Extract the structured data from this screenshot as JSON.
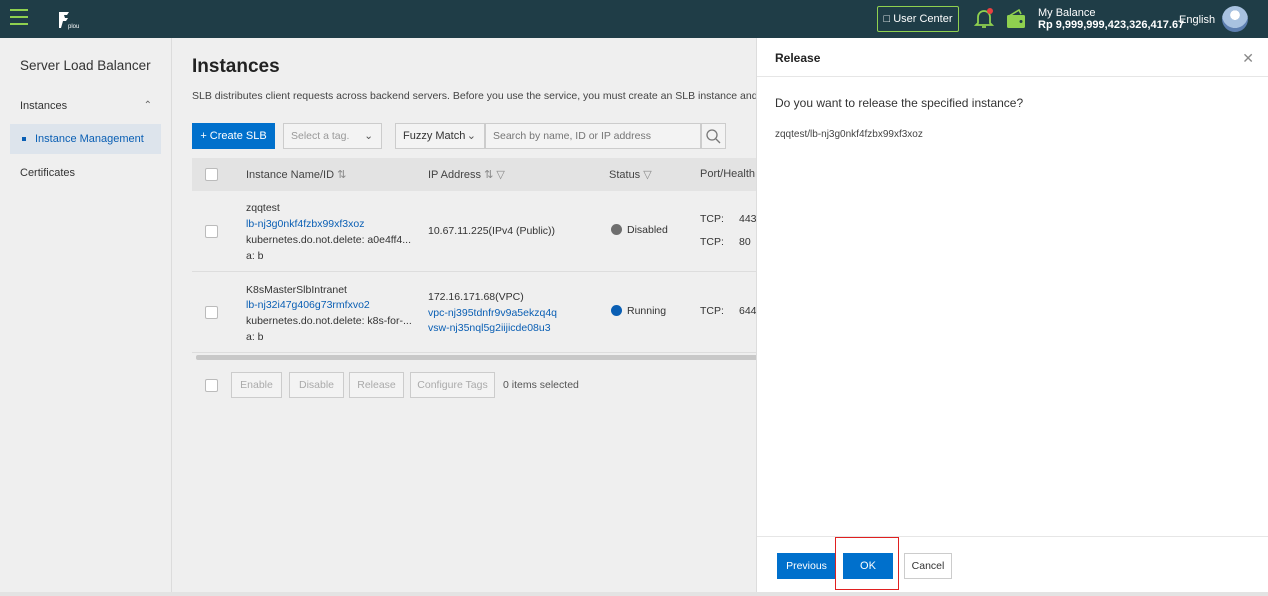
{
  "topbar": {
    "user_center": "User Center",
    "balance_label": "My Balance",
    "balance_value": "Rp 9,999,999,423,326,417.67",
    "language": "English",
    "logo_text": "plou"
  },
  "sidebar": {
    "title": "Server Load Balancer",
    "group": "Instances",
    "active_item": "Instance Management",
    "item_certificates": "Certificates"
  },
  "main": {
    "title": "Instances",
    "description": "SLB distributes client requests across backend servers. Before you use the service, you must create an SLB instance and then add l",
    "create_btn": "+ Create SLB",
    "tag_placeholder": "Select a tag.",
    "fuzzy_label": "Fuzzy Match",
    "search_placeholder": "Search by name, ID or IP address",
    "columns": [
      "Instance Name/ID",
      "IP Address",
      "Status",
      "Port/Health"
    ],
    "rows": [
      {
        "name": "zqqtest",
        "id": "lb-nj3g0nkf4fzbx99xf3xoz",
        "tag": "kubernetes.do.not.delete: a0e4ff4...",
        "tag2": "a: b",
        "ip": "10.67.11.225(IPv4 (Public))",
        "status": "Disabled",
        "ports": [
          "TCP:",
          "443",
          "TCP:",
          "80"
        ]
      },
      {
        "name": "K8sMasterSlbIntranet",
        "id": "lb-nj32i47g406g73rmfxvo2",
        "tag": "kubernetes.do.not.delete: k8s-for-...",
        "tag2": "a: b",
        "ip": "172.16.171.68(VPC)",
        "vpc": "vpc-nj395tdnfr9v9a5ekzq4q",
        "vsw": "vsw-nj35nql5g2iijicde08u3",
        "status": "Running",
        "ports": [
          "TCP:",
          "644"
        ]
      }
    ],
    "bulk": {
      "enable": "Enable",
      "disable": "Disable",
      "release": "Release",
      "configure_tags": "Configure Tags",
      "selected": "0 items selected"
    }
  },
  "panel": {
    "title": "Release",
    "question": "Do you want to release the specified instance?",
    "instance": "zqqtest/lb-nj3g0nkf4fzbx99xf3xoz",
    "previous": "Previous",
    "ok": "OK",
    "cancel": "Cancel"
  },
  "colors": {
    "topbar": "#1f3d47",
    "accent_green": "#8fd14f",
    "primary": "#0070cc",
    "link": "#0a5fb4",
    "highlight": "#e02020"
  }
}
